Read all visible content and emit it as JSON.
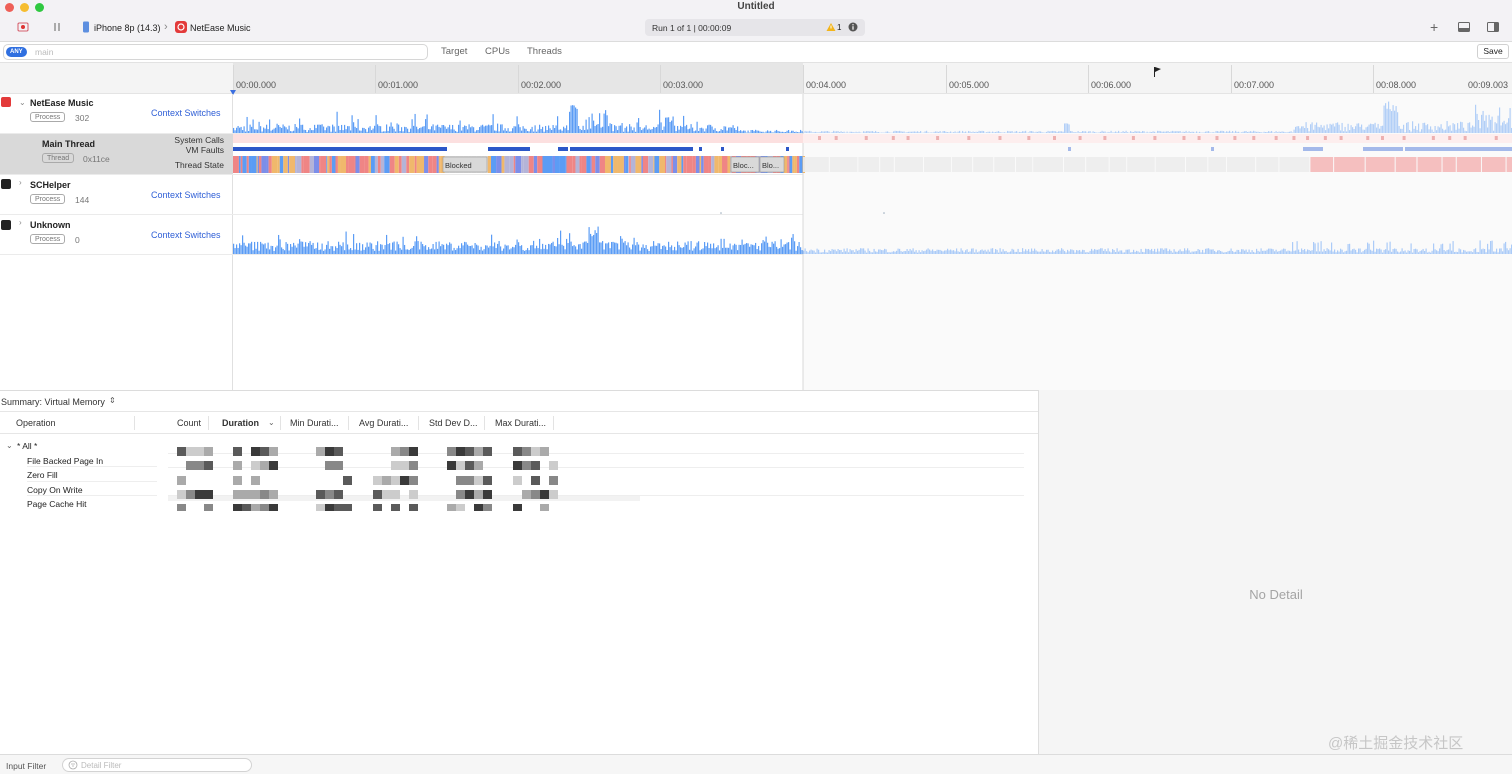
{
  "window": {
    "title": "Untitled"
  },
  "toolbar": {
    "device": "iPhone 8p (14.3)",
    "app": "NetEase Music",
    "run_status": "Run 1 of 1  |  00:00:09",
    "warning_count": "1"
  },
  "filter_bar": {
    "scope_pill": "ANY",
    "search_placeholder": "main",
    "tabs": [
      "Target",
      "CPUs",
      "Threads"
    ],
    "save_label": "Save"
  },
  "ruler": {
    "ticks": [
      "00:00.000",
      "00:01.000",
      "00:02.000",
      "00:03.000",
      "00:04.000",
      "00:05.000",
      "00:06.000",
      "00:07.000",
      "00:08.000",
      "00:09.003"
    ]
  },
  "tracks": {
    "netease": {
      "name": "NetEase Music",
      "tag": "Process",
      "pid": "302",
      "link": "Context Switches"
    },
    "main_thread": {
      "name": "Main Thread",
      "tag": "Thread",
      "tid": "0x11ce",
      "lanes": [
        "System Calls",
        "VM Faults",
        "Thread State"
      ],
      "state_labels": [
        "Blocked",
        "Bloc...",
        "Blo..."
      ]
    },
    "schelper": {
      "name": "SCHelper",
      "tag": "Process",
      "pid": "144",
      "link": "Context Switches"
    },
    "unknown": {
      "name": "Unknown",
      "tag": "Process",
      "pid": "0",
      "link": "Context Switches"
    }
  },
  "summary": {
    "title": "Summary: Virtual Memory",
    "columns": [
      "Operation",
      "Count",
      "Duration",
      "Min Durati...",
      "Avg Durati...",
      "Std Dev D...",
      "Max Durati..."
    ],
    "rows": [
      "* All *",
      "File Backed Page In",
      "Zero Fill",
      "Copy On Write",
      "Page Cache Hit"
    ]
  },
  "detail": {
    "empty_text": "No Detail"
  },
  "footer": {
    "input_filter": "Input Filter",
    "detail_filter_placeholder": "Detail Filter"
  },
  "watermark": "@稀土掘金技术社区",
  "colors": {
    "accent": "#2f5fd6",
    "cpu_blue": "#5b9cf5",
    "blocked_red": "#ef8585",
    "syscall_pink": "#f9c4c4"
  }
}
